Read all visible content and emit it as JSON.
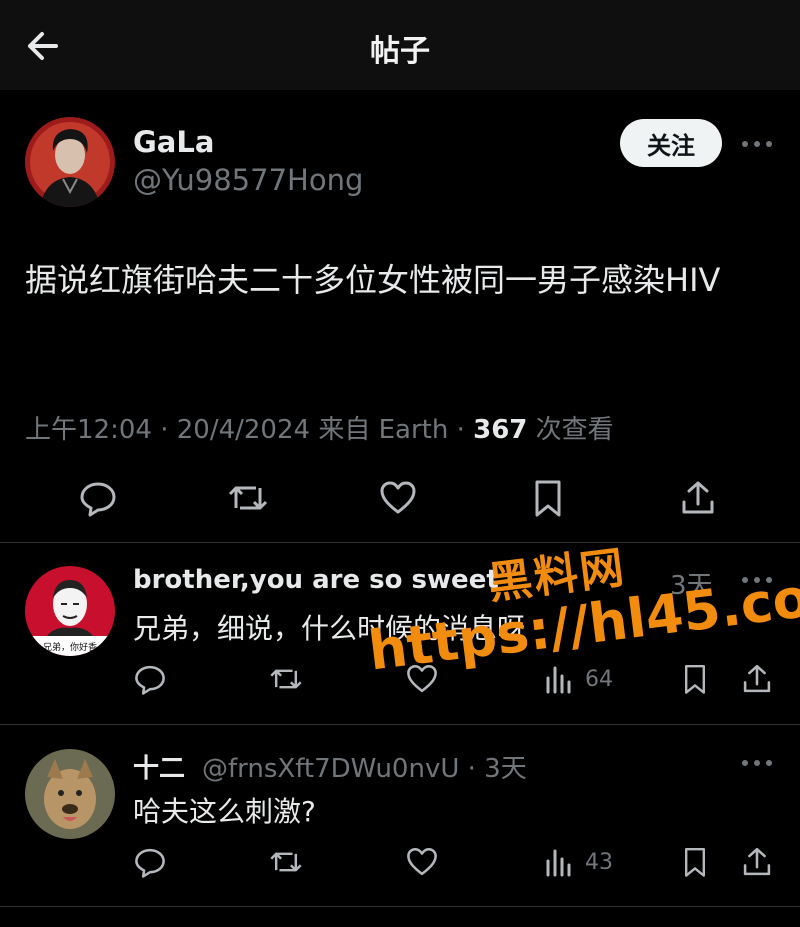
{
  "header": {
    "title": "帖子"
  },
  "post": {
    "author_name": "GaLa",
    "author_handle": "@Yu98577Hong",
    "follow_label": "关注",
    "text": "据说红旗街哈夫二十多位女性被同一男子感染HIV",
    "time": "上午12:04",
    "date": "20/4/2024",
    "source": "来自 Earth",
    "views_count": "367",
    "views_label": "次查看"
  },
  "replies": [
    {
      "name": "brother,you are so sweet",
      "handle": "",
      "time": "3天",
      "text": "兄弟，细说，什么时候的消息呀",
      "views": "64",
      "avatar_caption": "兄弟，你好香"
    },
    {
      "name": "十二",
      "handle": "@frnsXft7DWu0nvU",
      "time": "3天",
      "text": "哈夫这么刺激?",
      "views": "43"
    }
  ],
  "watermark": {
    "line1": "黑料网",
    "line2": "https://hl45.co"
  },
  "colors": {
    "background": "#000000",
    "text": "#e7e9ea",
    "muted": "#71767b",
    "watermark": "#f28c0f"
  }
}
